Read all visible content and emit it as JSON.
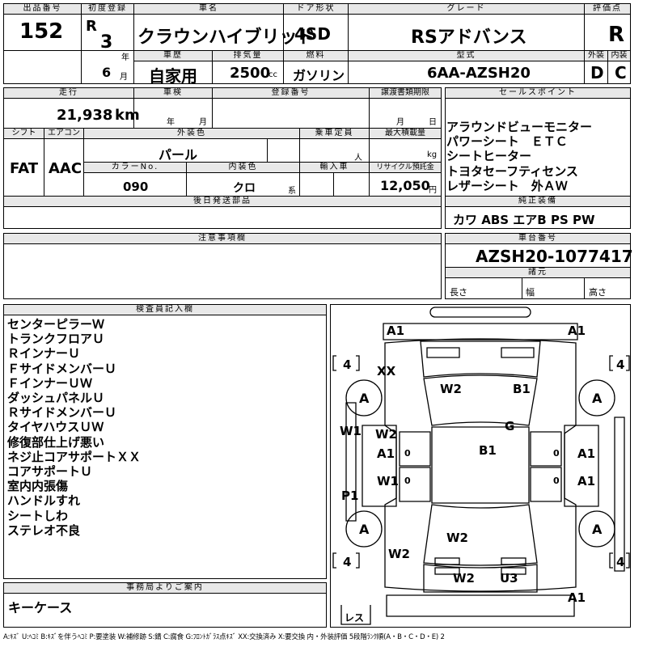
{
  "header": {
    "lot_no_label": "出品番号",
    "lot_no": "152",
    "first_reg_label": "初度登録",
    "era": "R",
    "year": "3",
    "year_unit": "年",
    "month": "6",
    "month_unit": "月",
    "car_name_label": "車名",
    "car_name": "クラウンハイブリッド",
    "door_label": "ドア形状",
    "door": "4SD",
    "grade_label": "グレード",
    "grade": "RSアドバンス",
    "score_label": "評価点",
    "score": "R",
    "history_label": "車歴",
    "history": "自家用",
    "displacement_label": "排気量",
    "displacement": "2500",
    "displacement_unit": "cc",
    "fuel_label": "燃料",
    "fuel": "ガソリン",
    "model_label": "型式",
    "model": "6AA-AZSH20",
    "exterior_label": "外装",
    "exterior": "D",
    "interior_label": "内装",
    "interior": "C"
  },
  "row2": {
    "mileage_label": "走行",
    "mileage": "21,938",
    "mileage_unit": "km",
    "inspection_label": "車検",
    "ins_year": "年",
    "ins_month": "月",
    "reg_no_label": "登録番号",
    "transfer_label": "譲渡書類期限",
    "tr_month": "月",
    "tr_day": "日",
    "shift_label": "シフト",
    "shift": "FAT",
    "ac_label": "エアコン",
    "ac": "AAC",
    "color_label": "外装色",
    "color": "パール",
    "capacity_label": "乗車定員",
    "capacity_unit": "人",
    "load_label": "最大積載量",
    "load_unit": "kg",
    "color_no_label": "カラーNo.",
    "color_no": "090",
    "int_color_label": "内装色",
    "int_color": "クロ",
    "int_color_unit": "系",
    "import_label": "輸入車",
    "recycle_label": "リサイクル預託金",
    "recycle": "12,050",
    "recycle_unit": "円",
    "later_parts_label": "後日発送部品"
  },
  "sales": {
    "label": "セールスポイント",
    "points": [
      "アラウンドビューモニター",
      "パワーシート　ＥＴＣ",
      "シートヒーター",
      "トヨタセーフティセンス",
      "レザーシート　外ＡＷ"
    ]
  },
  "equipment": {
    "label": "純正装備",
    "value": "カワ ABS エアB PS PW"
  },
  "notes": {
    "label": "注意事項欄"
  },
  "chassis": {
    "label": "車台番号",
    "value": "AZSH20-1077417",
    "spec_label": "諸元",
    "length": "長さ",
    "width": "幅",
    "height": "高さ"
  },
  "inspector": {
    "label": "検査員記入欄",
    "lines": [
      "センターピラーＷ",
      "トランクフロアＵ",
      "ＲインナーＵ",
      "ＦサイドメンバーＵ",
      "ＦインナーＵＷ",
      "ダッシュパネルＵ",
      "ＲサイドメンバーＵ",
      "タイヤハウスＵＷ",
      "修復部仕上げ悪い",
      "ネジ止コアサポートＸＸ",
      "コアサポートＵ",
      "室内内張傷",
      "ハンドルすれ",
      "シートしわ",
      "ステレオ不良"
    ]
  },
  "office": {
    "label": "事務局よりご案内",
    "value": "キーケース"
  },
  "diagram": {
    "marks": [
      "A1",
      "A1",
      "XX",
      "W2",
      "B1",
      "W1",
      "W2",
      "G",
      "A1",
      "B1",
      "A1",
      "W1",
      "A1",
      "P1",
      "W2",
      "W2",
      "W2",
      "U3",
      "A1"
    ],
    "tires": [
      "A",
      "A",
      "A",
      "A"
    ],
    "tire_tread": [
      "4",
      "4",
      "4",
      "4"
    ],
    "zeros": [
      "0",
      "0",
      "0",
      "0"
    ],
    "spare": "レス"
  },
  "legend": "A:ｷｽﾞ U:ﾍｺﾐ B:ｷｽﾞを伴うﾍｺﾐ P:要塗装 W:補修跡 S:錆 C:腐食 G:ﾌﾛﾝﾄｶﾞﾗｽ点ｷｽﾞ XX:交換済み X:要交換 内・外装評価 5段階ﾗﾝｸ順(A・B・C・D・E) 2"
}
